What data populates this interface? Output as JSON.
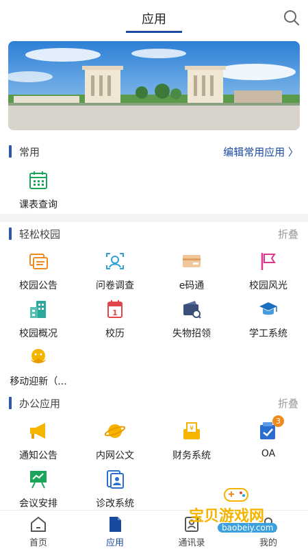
{
  "header": {
    "title": "应用"
  },
  "common": {
    "title": "常用",
    "edit_label": "编辑常用应用",
    "apps": [
      {
        "label": "课表查询",
        "icon": "calendar-grid-icon"
      }
    ]
  },
  "campus": {
    "title": "轻松校园",
    "toggle_label": "折叠",
    "apps": [
      {
        "label": "校园公告",
        "icon": "notice-board-icon"
      },
      {
        "label": "问卷调查",
        "icon": "survey-face-icon"
      },
      {
        "label": "e码通",
        "icon": "card-icon"
      },
      {
        "label": "校园风光",
        "icon": "flag-icon"
      },
      {
        "label": "校园概况",
        "icon": "building-icon"
      },
      {
        "label": "校历",
        "icon": "calendar-day-icon"
      },
      {
        "label": "失物招领",
        "icon": "wallet-search-icon"
      },
      {
        "label": "学工系统",
        "icon": "graduation-cap-icon"
      },
      {
        "label": "移动迎新（...",
        "icon": "welcome-hands-icon"
      }
    ]
  },
  "office": {
    "title": "办公应用",
    "toggle_label": "折叠",
    "apps": [
      {
        "label": "通知公告",
        "icon": "megaphone-icon"
      },
      {
        "label": "内网公文",
        "icon": "planet-icon"
      },
      {
        "label": "财务系统",
        "icon": "finance-icon"
      },
      {
        "label": "OA",
        "icon": "oa-check-icon",
        "badge": "3"
      },
      {
        "label": "会议安排",
        "icon": "meeting-board-icon"
      },
      {
        "label": "诊改系统",
        "icon": "diagnosis-doc-icon"
      }
    ]
  },
  "tabbar": {
    "tabs": [
      {
        "label": "首页",
        "icon": "home-icon"
      },
      {
        "label": "应用",
        "icon": "app-doc-icon",
        "active": true
      },
      {
        "label": "通讯录",
        "icon": "contacts-icon"
      },
      {
        "label": "我的",
        "icon": "profile-icon"
      }
    ]
  },
  "watermark": {
    "text": "宝贝游戏网",
    "url": "baobeiy.com"
  },
  "colors": {
    "accent": "#1a4aa0",
    "orange": "#f08a1e",
    "green": "#1aa55a",
    "teal": "#2aa89a"
  }
}
